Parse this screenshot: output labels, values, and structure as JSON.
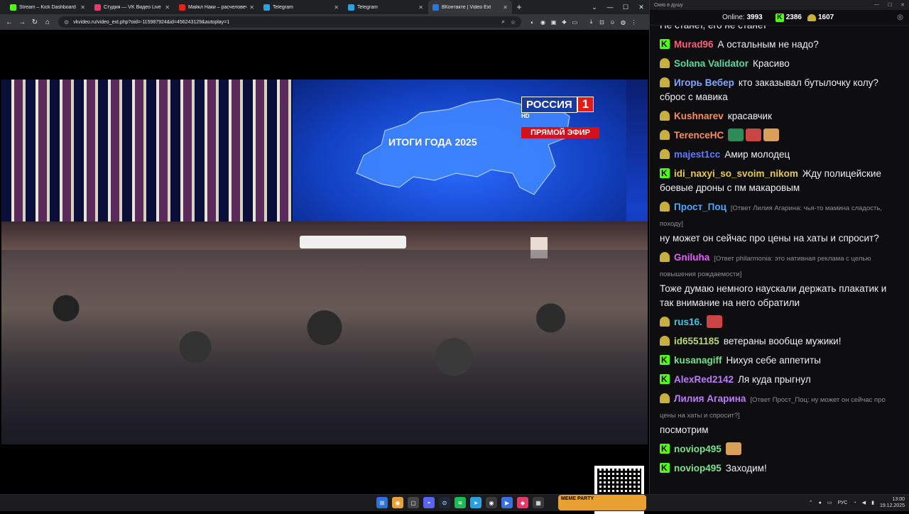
{
  "browser": {
    "tabs": [
      {
        "label": "Stream – Kick Dashboard",
        "icon": "kick-icon",
        "color": "#53fc18"
      },
      {
        "label": "Студия — VK Видео Live",
        "icon": "vk-video-icon",
        "color": "#e63a6a"
      },
      {
        "label": "Майкл Наки – расчеловечива…",
        "icon": "youtube-icon",
        "color": "#e62117"
      },
      {
        "label": "Telegram",
        "icon": "telegram-icon",
        "color": "#2aa1e0"
      },
      {
        "label": "Telegram",
        "icon": "telegram-icon",
        "color": "#2aa1e0"
      },
      {
        "label": "ВКонтакте | Video Ext",
        "icon": "vk-icon",
        "color": "#2a78e6"
      }
    ],
    "url": "vkvideo.ru/video_ext.php?oid=-115987924&id=456243129&autoplay=1"
  },
  "video": {
    "channel_name": "РОССИЯ",
    "channel_number": "1",
    "channel_suffix": "HD",
    "live_label": "ПРЯМОЙ ЭФИР",
    "screen_title": "ИТОГИ ГОДА 2025"
  },
  "chat": {
    "window_title": "Окно в душу",
    "online_label": "Online:",
    "online_count": "3993",
    "kick_count": "2386",
    "vk_count": "1607",
    "partial_top": "Не станет, его не станет",
    "messages": [
      {
        "icon": "kick",
        "user": "Murad96",
        "color": "#ff5c7a",
        "text": "А остальным не надо?"
      },
      {
        "icon": "viewer",
        "user": "Solana Validator",
        "color": "#57d9a3",
        "text": "Красиво"
      },
      {
        "icon": "viewer",
        "user": "Игорь Вебер",
        "color": "#7fa8ff",
        "text": "кто заказывал бутылочку колу? сброс с мавика"
      },
      {
        "icon": "viewer",
        "user": "Kushnarev",
        "color": "#ff8a5c",
        "text": "красавчик"
      },
      {
        "icon": "viewer",
        "user": "TerenceHC",
        "color": "#ff8a5c",
        "text": "",
        "emotes": 3
      },
      {
        "icon": "viewer",
        "user": "majest1cc",
        "color": "#5b7cff",
        "text": "Амир молодец"
      },
      {
        "icon": "kick",
        "user": "idi_naxyi_so_svoim_nikom",
        "color": "#e8c84a",
        "text": "Жду полицейские боевые дроны с пм макаровым"
      },
      {
        "icon": "viewer",
        "user": "Прост_Поц",
        "color": "#4aa8ff",
        "reply": "[Ответ Лилия Агарина: чья-то мамина сладость, походу]",
        "text": "ну может он сейчас про цены на хаты и спросит?"
      },
      {
        "icon": "viewer",
        "user": "Gniluha",
        "color": "#e85cff",
        "reply": "[Ответ philarmonia: это нативная реклама с целью повышения рождаемости]",
        "text": "Тоже думаю немного наускали держать плакатик и так внимание на него обратили"
      },
      {
        "icon": "viewer",
        "user": "rus16.",
        "color": "#3ac8e0",
        "text": "",
        "emotes": 1
      },
      {
        "icon": "viewer",
        "user": "id6551185",
        "color": "#b8d86a",
        "text": "ветераны вообще мужики!"
      },
      {
        "icon": "kick",
        "user": "kusanagiff",
        "color": "#72e08a",
        "text": "Нихуя себе аппетиты"
      },
      {
        "icon": "kick",
        "user": "AlexRed2142",
        "color": "#c07aff",
        "text": "Ля куда прыгнул"
      },
      {
        "icon": "viewer",
        "user": "Лилия Агарина",
        "color": "#c07aff",
        "reply": "[Ответ Прост_Поц: ну может он сейчас про цены на хаты и спросит?]",
        "text": "посмотрим"
      },
      {
        "icon": "kick",
        "user": "noviop495",
        "color": "#7de08a",
        "text": "",
        "emotes": 1
      },
      {
        "icon": "kick",
        "user": "noviop495",
        "color": "#7de08a",
        "text": "Заходим!"
      }
    ]
  },
  "taskbar": {
    "meme_label": "MEME PARTY",
    "lang": "РУС",
    "time": "13:00",
    "date": "19.12.2025"
  }
}
